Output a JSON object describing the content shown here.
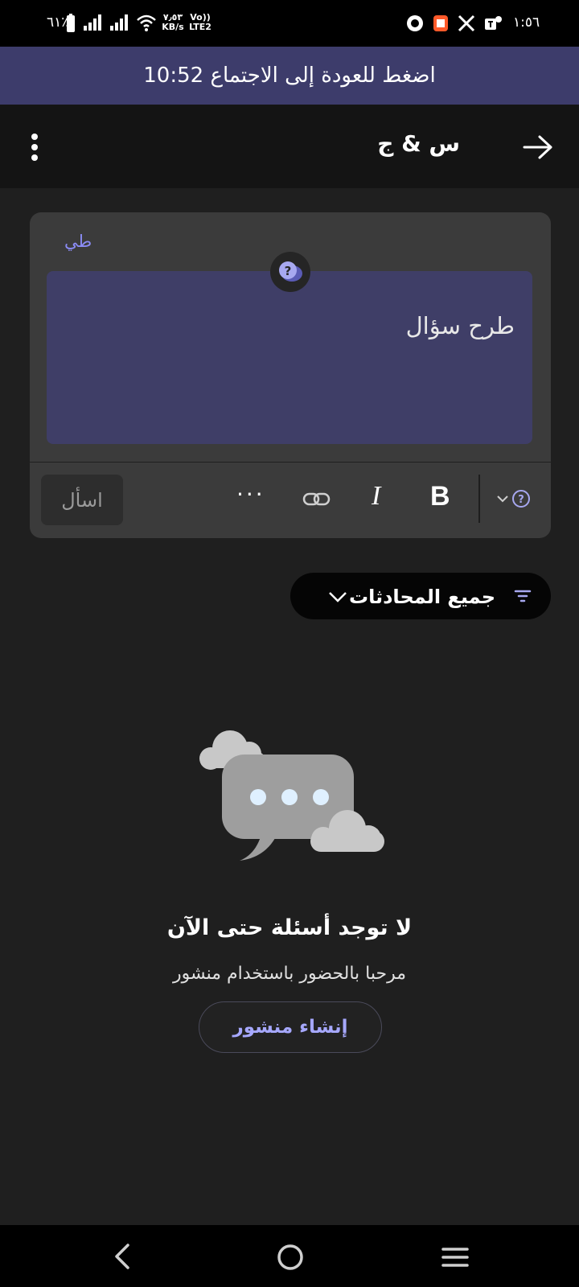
{
  "status_bar": {
    "battery": "٦١٪",
    "net_speed_value": "٧٫٥٣",
    "net_speed_unit": "KB/s",
    "volte_label": "Vo))",
    "lte_label": "LTE2",
    "time": "١:٥٦"
  },
  "banner": {
    "text": "اضغط للعودة إلى الاجتماع 10:52"
  },
  "header": {
    "title": "س & ج"
  },
  "compose": {
    "user_tag": "طي",
    "placeholder": "طرح سؤال",
    "ask_label": "اسأل",
    "bold_label": "B",
    "italic_label": "I",
    "more_label": "···"
  },
  "filter": {
    "label": "جميع المحادثات"
  },
  "empty_state": {
    "title": "لا توجد أسئلة حتى الآن",
    "subtitle": "مرحبا بالحضور باستخدام منشور",
    "create_label": "إنشاء منشور"
  },
  "colors": {
    "accent": "#8b8cf5",
    "banner": "#3d3c6b",
    "input_bg": "#3f3e67",
    "background": "#1f1f1f"
  }
}
